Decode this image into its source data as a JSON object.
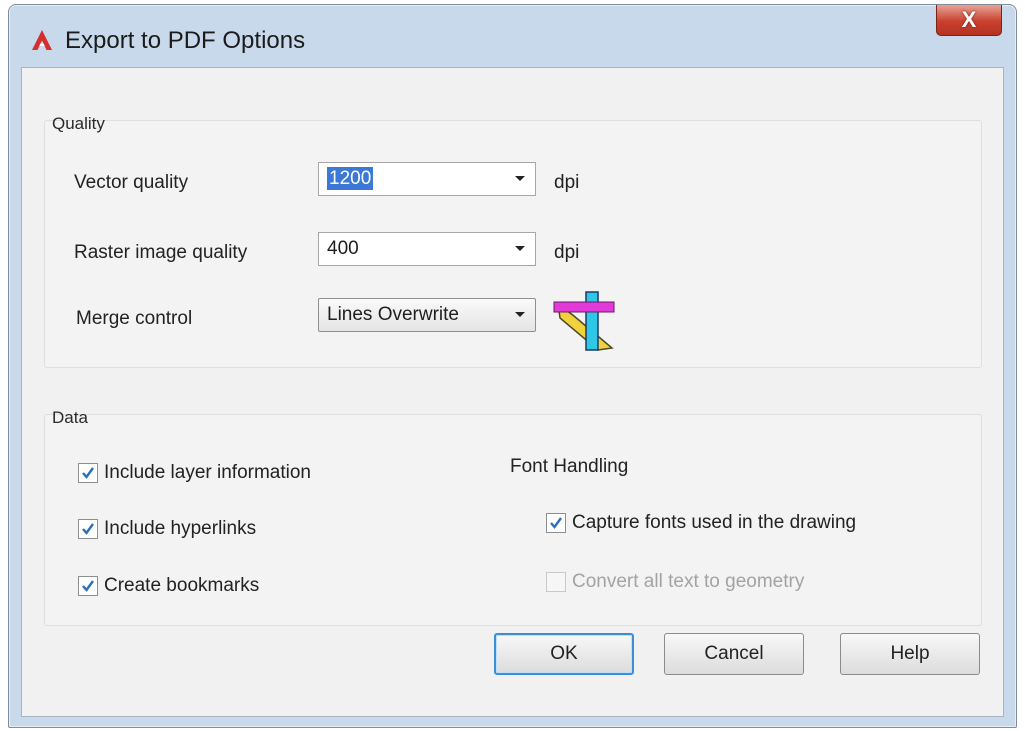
{
  "window": {
    "title": "Export to PDF Options",
    "close_label": "X"
  },
  "quality": {
    "group_label": "Quality",
    "vector": {
      "label": "Vector quality",
      "value": "1200",
      "unit": "dpi"
    },
    "raster": {
      "label": "Raster image quality",
      "value": "400",
      "unit": "dpi"
    },
    "merge": {
      "label": "Merge control",
      "value": "Lines Overwrite"
    }
  },
  "data": {
    "group_label": "Data",
    "include_layer": {
      "label": "Include layer information",
      "checked": true
    },
    "include_hyperlinks": {
      "label": "Include hyperlinks",
      "checked": true
    },
    "create_bookmarks": {
      "label": "Create bookmarks",
      "checked": true
    },
    "font_handling": {
      "label": "Font Handling",
      "capture_fonts": {
        "label": "Capture fonts used in the drawing",
        "checked": true
      },
      "convert_text": {
        "label": "Convert all text to geometry",
        "checked": false,
        "disabled": true
      }
    }
  },
  "buttons": {
    "ok": "OK",
    "cancel": "Cancel",
    "help": "Help"
  },
  "colors": {
    "accent": "#3b78d8",
    "close": "#c8412e",
    "app_icon": "#d32f2f"
  },
  "icons": {
    "app": "autocad-a-icon",
    "merge_preview": "merge-lines-overwrite-icon",
    "dropdown": "chevron-down-icon",
    "check": "checkmark-icon"
  }
}
